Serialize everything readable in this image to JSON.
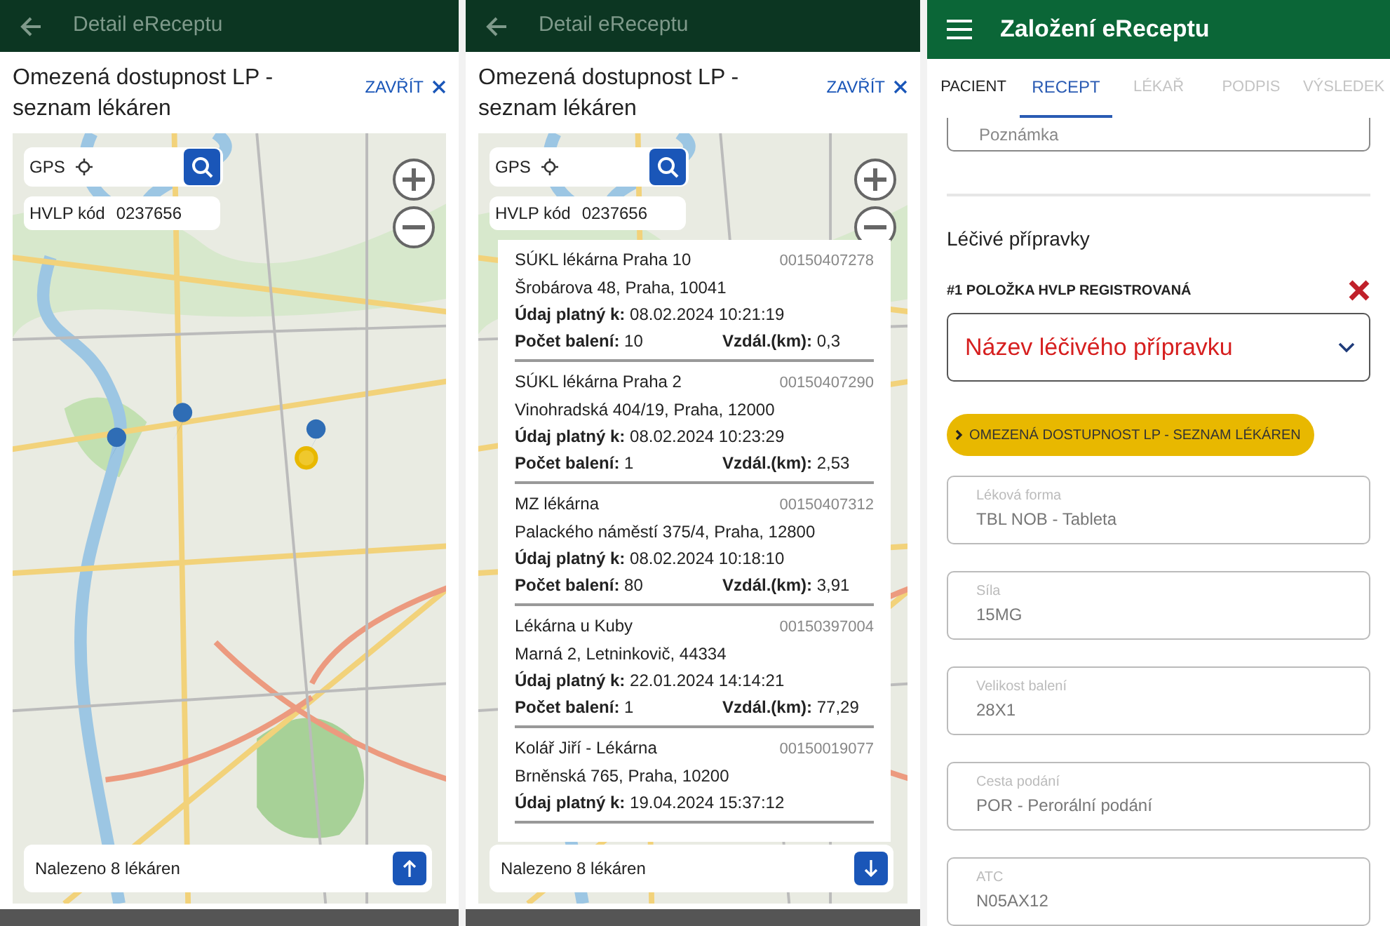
{
  "screens": [
    {
      "kind": "map_dialog",
      "app_bar": {
        "title": "Detail eReceptu"
      },
      "dialog": {
        "title": "Omezená dostupnost LP - seznam lékáren",
        "close_label": "ZAVŘÍT",
        "gps_label": "GPS",
        "hvlp_label": "HVLP kód",
        "hvlp_code": "0237656",
        "sheet_expanded": false,
        "found_text": "Nalezeno 8 lékáren"
      }
    },
    {
      "kind": "map_dialog",
      "app_bar": {
        "title": "Detail eReceptu"
      },
      "dialog": {
        "title": "Omezená dostupnost LP - seznam lékáren",
        "close_label": "ZAVŘÍT",
        "gps_label": "GPS",
        "hvlp_label": "HVLP kód",
        "hvlp_code": "0237656",
        "sheet_expanded": true,
        "found_text": "Nalezeno 8 lékáren",
        "pharmacies": [
          {
            "name": "SÚKL lékárna Praha 10",
            "code": "00150407278",
            "address": "Šrobárova 48, Praha, 10041",
            "valid_label": "Údaj platný k:",
            "valid_value": "08.02.2024 10:21:19",
            "count_label": "Počet balení:",
            "count_value": "10",
            "distance_label": "Vzdál.(km):",
            "distance_value": "0,3"
          },
          {
            "name": "SÚKL lékárna Praha 2",
            "code": "00150407290",
            "address": "Vinohradská 404/19, Praha, 12000",
            "valid_label": "Údaj platný k:",
            "valid_value": "08.02.2024 10:23:29",
            "count_label": "Počet balení:",
            "count_value": "1",
            "distance_label": "Vzdál.(km):",
            "distance_value": "2,53"
          },
          {
            "name": "MZ lékárna",
            "code": "00150407312",
            "address": "Palackého náměstí 375/4, Praha, 12800",
            "valid_label": "Údaj platný k:",
            "valid_value": "08.02.2024 10:18:10",
            "count_label": "Počet balení:",
            "count_value": "80",
            "distance_label": "Vzdál.(km):",
            "distance_value": "3,91"
          },
          {
            "name": "Lékárna u Kuby",
            "code": "00150397004",
            "address": "Marná 2, Letninkovič, 44334",
            "valid_label": "Údaj platný k:",
            "valid_value": "22.01.2024 14:14:21",
            "count_label": "Počet balení:",
            "count_value": "1",
            "distance_label": "Vzdál.(km):",
            "distance_value": "77,29"
          },
          {
            "name": "Kolář Jiří - Lékárna",
            "code": "00150019077",
            "address": "Brněnská 765, Praha, 10200",
            "valid_label": "Údaj platný k:",
            "valid_value": "19.04.2024 15:37:12"
          }
        ]
      }
    },
    {
      "kind": "form",
      "app_bar": {
        "title": "Založení eReceptu"
      },
      "tabs": [
        {
          "label": "PACIENT",
          "selected": false,
          "disabled": false
        },
        {
          "label": "RECEPT",
          "selected": true,
          "disabled": false
        },
        {
          "label": "LÉKAŘ",
          "selected": false,
          "disabled": true
        },
        {
          "label": "PODPIS",
          "selected": false,
          "disabled": true
        },
        {
          "label": "VÝSLEDEK",
          "selected": false,
          "disabled": true
        }
      ],
      "note_field": {
        "placeholder": "Poznámka"
      },
      "section_title": "Léčivé přípravky",
      "item": {
        "header": "#1 POLOŽKA HVLP REGISTROVANÁ",
        "product_select": {
          "placeholder": "Název léčivého přípravku"
        },
        "availability_button": "OMEZENÁ DOSTUPNOST LP - SEZNAM LÉKÁREN",
        "fields": [
          {
            "label": "Léková forma",
            "value": "TBL NOB - Tableta",
            "disabled": true
          },
          {
            "label": "Síla",
            "value": "15MG",
            "disabled": true
          },
          {
            "label": "Velikost balení",
            "value": "28X1",
            "disabled": true
          },
          {
            "label": "Cesta podání",
            "value": "POR - Perorální podání",
            "disabled": true
          },
          {
            "label": "ATC",
            "value": "N05AX12",
            "disabled": true
          }
        ]
      }
    }
  ]
}
